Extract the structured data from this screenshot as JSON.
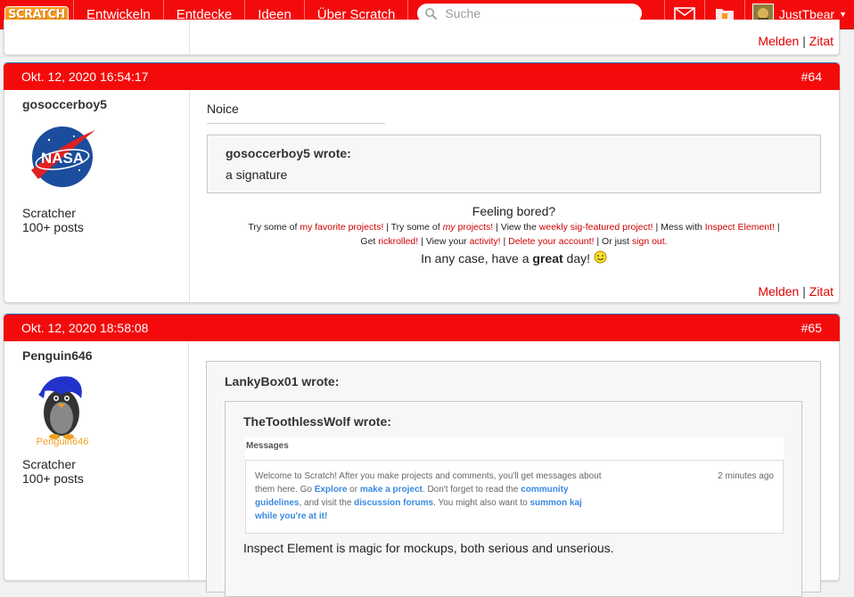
{
  "nav": {
    "logo": "SCRATCH",
    "items": [
      "Entwickeln",
      "Entdecke",
      "Ideen",
      "Über Scratch"
    ],
    "search_placeholder": "Suche",
    "username": "JustTbear"
  },
  "links": {
    "report": "Melden",
    "sep": "|",
    "quote": "Zitat"
  },
  "post64": {
    "date": "Okt. 12, 2020 16:54:17",
    "number": "#64",
    "user": "gosoccerboy5",
    "rank": "Scratcher",
    "posts": "100+ posts",
    "avatar_text": "NASA",
    "message": "Noice",
    "quote_author": "gosoccerboy5 wrote:",
    "quote_text": "a signature",
    "sig": {
      "line1": "Feeling bored?",
      "l2_a": "Try some of ",
      "l2_b": "my favorite projects!",
      "l2_c": " | Try some of ",
      "l2_d": "my",
      "l2_e": " projects!",
      "l2_f": " | View the ",
      "l2_g": "weekly sig-featured project!",
      "l2_h": " | Mess with ",
      "l2_i": "Inspect Element!",
      "l2_j": " |",
      "l3_a": "Get ",
      "l3_b": "rickrolled!",
      "l3_c": " | View your ",
      "l3_d": "activity!",
      "l3_e": " | ",
      "l3_f": "Delete your account!",
      "l3_g": " | Or just ",
      "l3_h": "sign out.",
      "l4_a": "In any case, have a ",
      "l4_b": "great",
      "l4_c": " day!"
    }
  },
  "post65": {
    "date": "Okt. 12, 2020 18:58:08",
    "number": "#65",
    "user": "Penguin646",
    "rank": "Scratcher",
    "posts": "100+ posts",
    "avatar_text": "Penguin646",
    "q1_author": "LankyBox01 wrote:",
    "q2_author": "TheToothlessWolf wrote:",
    "messages_header": "Messages",
    "msg_time": "2 minutes ago",
    "msg": {
      "a": "Welcome to Scratch! After you make projects and comments, you'll get messages about them here. Go ",
      "b": "Explore",
      "c": " or ",
      "d": "make a project",
      "e": ". Don't forget to read the ",
      "f": "community guidelines",
      "g": ", and visit the ",
      "h": "discussion forums",
      "i": ". You might also want to ",
      "j": "summon kaj while you're at it!"
    },
    "q2_text": "Inspect Element is magic for mockups, both serious and unserious."
  }
}
